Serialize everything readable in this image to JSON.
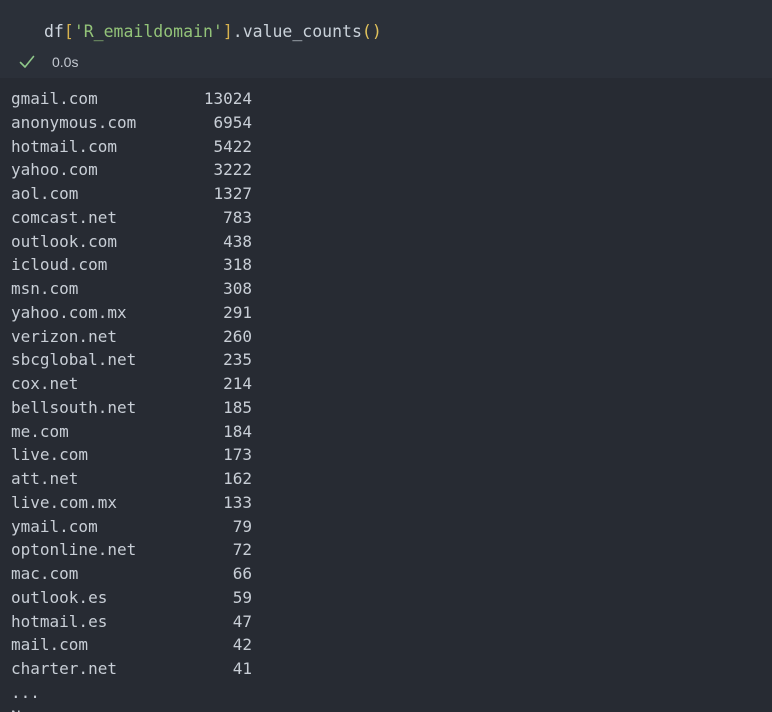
{
  "cell": {
    "code": {
      "var": "df",
      "open_bracket": "[",
      "string": "'R_emaildomain'",
      "close_bracket": "]",
      "method": ".value_counts",
      "parens": "()"
    },
    "status": {
      "icon": "checkmark-icon",
      "time": "0.0s",
      "color": "#8fc88a"
    }
  },
  "output": {
    "rows": [
      {
        "domain": "gmail.com",
        "count": "13024"
      },
      {
        "domain": "anonymous.com",
        "count": "6954"
      },
      {
        "domain": "hotmail.com",
        "count": "5422"
      },
      {
        "domain": "yahoo.com",
        "count": "3222"
      },
      {
        "domain": "aol.com",
        "count": "1327"
      },
      {
        "domain": "comcast.net",
        "count": "783"
      },
      {
        "domain": "outlook.com",
        "count": "438"
      },
      {
        "domain": "icloud.com",
        "count": "318"
      },
      {
        "domain": "msn.com",
        "count": "308"
      },
      {
        "domain": "yahoo.com.mx",
        "count": "291"
      },
      {
        "domain": "verizon.net",
        "count": "260"
      },
      {
        "domain": "sbcglobal.net",
        "count": "235"
      },
      {
        "domain": "cox.net",
        "count": "214"
      },
      {
        "domain": "bellsouth.net",
        "count": "185"
      },
      {
        "domain": "me.com",
        "count": "184"
      },
      {
        "domain": "live.com",
        "count": "173"
      },
      {
        "domain": "att.net",
        "count": "162"
      },
      {
        "domain": "live.com.mx",
        "count": "133"
      },
      {
        "domain": "ymail.com",
        "count": "79"
      },
      {
        "domain": "optonline.net",
        "count": "72"
      },
      {
        "domain": "mac.com",
        "count": "66"
      },
      {
        "domain": "outlook.es",
        "count": "59"
      },
      {
        "domain": "hotmail.es",
        "count": "47"
      },
      {
        "domain": "mail.com",
        "count": "42"
      },
      {
        "domain": "charter.net",
        "count": "41"
      }
    ],
    "ellipsis": "...",
    "cut_text": "Name: "
  }
}
